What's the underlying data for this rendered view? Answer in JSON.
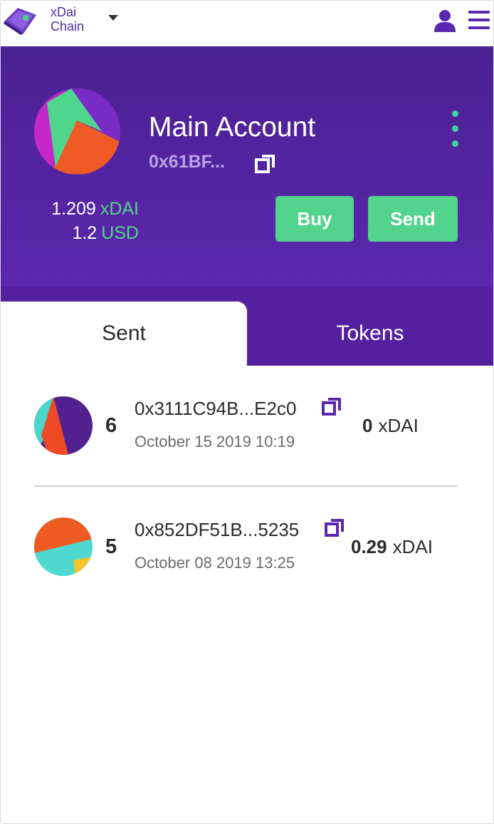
{
  "network": {
    "line1": "xDai",
    "line2": "Chain"
  },
  "account": {
    "name": "Main Account",
    "address_short": "0x61BF...",
    "balance_token": {
      "amount": "1.209",
      "unit": "xDAI"
    },
    "balance_fiat": {
      "amount": "1.2",
      "unit": "USD"
    },
    "buy_label": "Buy",
    "send_label": "Send"
  },
  "tabs": [
    {
      "label": "Sent",
      "active": true
    },
    {
      "label": "Tokens",
      "active": false
    }
  ],
  "transactions": [
    {
      "count": "6",
      "address": "0x3111C94B...E2c0",
      "date": "October 15 2019 10:19",
      "amount": "0",
      "unit": "xDAI"
    },
    {
      "count": "5",
      "address": "0x852DF51B...5235",
      "date": "October 08 2019 13:25",
      "amount": "0.29",
      "unit": "xDAI"
    }
  ],
  "icons": [
    "xdai-logo-icon",
    "caret-down-icon",
    "user-icon",
    "hamburger-menu-icon",
    "copy-icon",
    "kebab-menu-icon"
  ],
  "colors": {
    "brand_purple": "#5a27ae",
    "accent_green": "#52d48c",
    "address_lilac": "#b9a3e6"
  }
}
